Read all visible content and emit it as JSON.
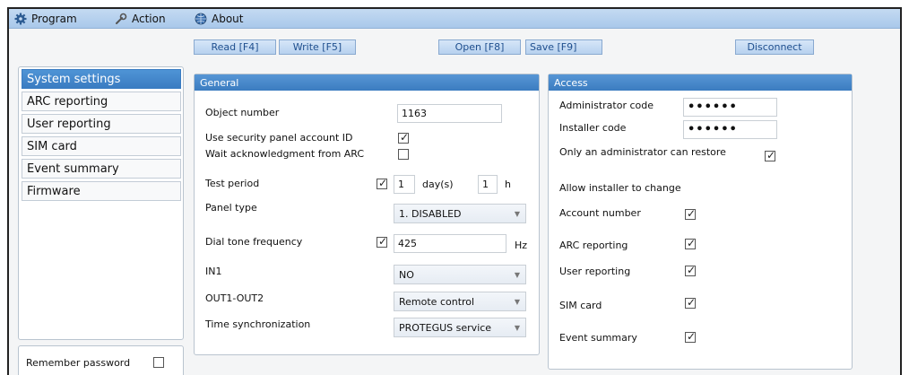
{
  "menu": {
    "program": "Program",
    "action": "Action",
    "about": "About"
  },
  "toolbar": {
    "read": "Read [F4]",
    "write": "Write [F5]",
    "open": "Open [F8]",
    "save": "Save [F9]",
    "disconnect": "Disconnect"
  },
  "sidebar": {
    "items": [
      {
        "label": "System settings"
      },
      {
        "label": "ARC reporting"
      },
      {
        "label": "User reporting"
      },
      {
        "label": "SIM card"
      },
      {
        "label": "Event summary"
      },
      {
        "label": "Firmware"
      }
    ],
    "remember_password": "Remember password"
  },
  "general": {
    "title": "General",
    "object_number_label": "Object number",
    "object_number": "1163",
    "use_account_id_label": "Use security panel account ID",
    "wait_ack_label": "Wait acknowledgment from ARC",
    "test_period_label": "Test period",
    "test_period_days": "1",
    "days_unit": "day(s)",
    "test_period_hours": "1",
    "hours_unit": "h",
    "panel_type_label": "Panel type",
    "panel_type": "1. DISABLED",
    "dial_tone_label": "Dial tone frequency",
    "dial_tone": "425",
    "hz_unit": "Hz",
    "in1_label": "IN1",
    "in1": "NO",
    "out_label": "OUT1-OUT2",
    "out": "Remote control",
    "time_sync_label": "Time synchronization",
    "time_sync": "PROTEGUS service"
  },
  "access": {
    "title": "Access",
    "admin_code_label": "Administrator code",
    "admin_code": "••••••",
    "installer_code_label": "Installer code",
    "installer_code": "••••••",
    "admin_restore_label": "Only an administrator can restore",
    "allow_change_label": "Allow installer to change",
    "account_number_label": "Account number",
    "arc_reporting_label": "ARC reporting",
    "user_reporting_label": "User reporting",
    "sim_card_label": "SIM card",
    "event_summary_label": "Event summary"
  },
  "colors": {
    "menubar": "#b7d1ef",
    "accent": "#3b7cc0"
  }
}
